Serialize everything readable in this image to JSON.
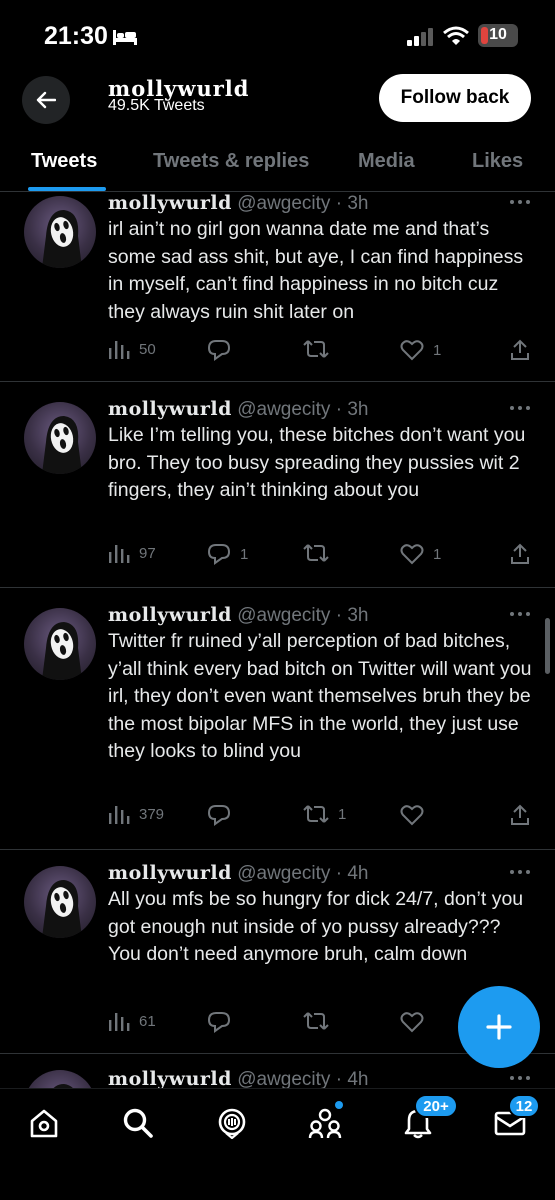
{
  "status_bar": {
    "time": "21:30",
    "battery": "10"
  },
  "header": {
    "name": "mollywurld",
    "tweet_count": "49.5K Tweets",
    "follow_label": "Follow back"
  },
  "tabs": [
    "Tweets",
    "Tweets & replies",
    "Media",
    "Likes"
  ],
  "tweets": [
    {
      "name": "mollywurld",
      "handle_time": "@awgecity · 3h",
      "text": "irl ain’t no girl gon wanna date me and that’s some sad ass shit, but aye, I can find happiness in myself, can’t find happiness in no bitch cuz they always ruin shit later on",
      "views": "50",
      "replies": "",
      "retweets": "",
      "likes": "1"
    },
    {
      "name": "mollywurld",
      "handle_time": "@awgecity · 3h",
      "text": "Like I’m telling you, these bitches don’t want you bro. They too busy spreading they pussies wit 2 fingers, they ain’t thinking about you",
      "views": "97",
      "replies": "1",
      "retweets": "",
      "likes": "1"
    },
    {
      "name": "mollywurld",
      "handle_time": "@awgecity · 3h",
      "text": "Twitter fr ruined y’all perception of bad bitches, y’all think every bad bitch on Twitter will want you irl, they don’t even want themselves bruh they be the most bipolar MFS in the world, they just use they looks to blind you",
      "views": "379",
      "replies": "",
      "retweets": "1",
      "likes": ""
    },
    {
      "name": "mollywurld",
      "handle_time": "@awgecity · 4h",
      "text": "All you mfs be so hungry for dick 24/7, don’t you got enough nut inside of yo pussy already??? You don’t need anymore bruh, calm down",
      "views": "61",
      "replies": "",
      "retweets": "",
      "likes": ""
    },
    {
      "name": "mollywurld",
      "handle_time": "@awgecity · 4h"
    }
  ],
  "nav": {
    "notifications_badge": "20+",
    "messages_badge": "12"
  },
  "icons": [
    "back-arrow-icon",
    "more-icon",
    "views-icon",
    "reply-icon",
    "retweet-icon",
    "like-icon",
    "share-icon",
    "compose-icon",
    "home-icon",
    "search-icon",
    "spaces-icon",
    "communities-icon",
    "notifications-icon",
    "messages-icon"
  ],
  "colors": {
    "accent": "#1d9bf0",
    "background": "#000000",
    "muted": "#71767b"
  }
}
